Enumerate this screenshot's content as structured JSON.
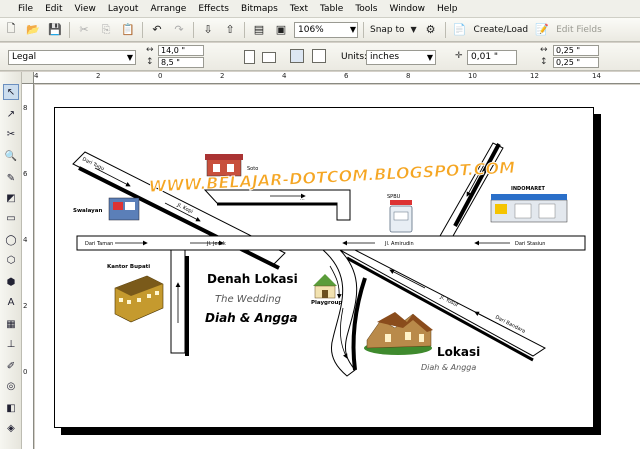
{
  "menu": [
    "File",
    "Edit",
    "View",
    "Layout",
    "Arrange",
    "Effects",
    "Bitmaps",
    "Text",
    "Table",
    "Tools",
    "Window",
    "Help"
  ],
  "toolbar": {
    "zoom": "106%",
    "snap_to": "Snap to",
    "create_load": "Create/Load",
    "edit_fields": "Edit Fields"
  },
  "propbar": {
    "paper": "Legal",
    "width": "14,0 \"",
    "height": "8,5 \"",
    "units_label": "Units:",
    "units": "inches",
    "nudge": "0,01 \"",
    "dup_x": "0,25 \"",
    "dup_y": "0,25 \""
  },
  "ruler": {
    "h_labels": [
      "4",
      "2",
      "0",
      "2",
      "4",
      "6",
      "8",
      "10",
      "12",
      "14"
    ],
    "v_labels": [
      "8",
      "6",
      "4",
      "2",
      "0"
    ]
  },
  "map": {
    "watermark": "WWW.BELAJAR-DOTCOM.BLOGSPOT.COM",
    "title": "Denah Lokasi",
    "the_wedding": "The Wedding",
    "couple": "Diah & Angga",
    "lokasi": "Lokasi",
    "lokasi_couple": "Diah & Angga",
    "streets": {
      "dari_tugu": "Dari Tugu",
      "jl_kopi": "Jl. Kopi",
      "dari_taman": "Dari Taman",
      "jl_jeruk": "Jl. Jeruk",
      "jl_amirudin": "Jl. Amirudin",
      "dari_stasiun": "Dari Stasiun",
      "jl_yusuf": "Jl. Yusuf",
      "dari_bandara": "Dari Bandara",
      "pojok": "..."
    },
    "landmarks": {
      "swalayan": "Swalayan",
      "kantor_bupati": "Kantor Bupati",
      "playgroup": "Playgroup",
      "indomaret": "INDOMARET",
      "spbu": "SPBU",
      "warung": "Soto"
    }
  }
}
